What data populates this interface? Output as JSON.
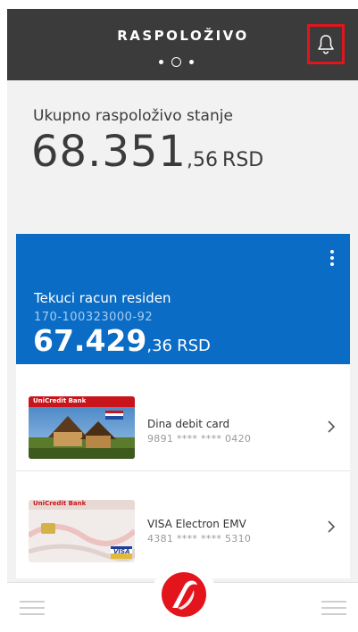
{
  "header": {
    "title": "RASPOLOŽIVO",
    "pager": {
      "count": 3,
      "active_index": 1
    }
  },
  "total": {
    "label": "Ukupno raspoloživo stanje",
    "amount_main": "68.351",
    "amount_decimals": ",56",
    "currency": "RSD"
  },
  "account": {
    "name": "Tekuci racun residen",
    "number": "170-100323000-92",
    "amount_main": "67.429",
    "amount_decimals": ",36",
    "currency": "RSD"
  },
  "cards": [
    {
      "name": "Dina debit card",
      "number": "9891 **** **** 0420",
      "bank_label": "UniCredit Bank"
    },
    {
      "name": "VISA Electron EMV",
      "number": "4381 **** **** 5310",
      "bank_label": "UniCredit Bank",
      "scheme_label": "VISA"
    }
  ],
  "colors": {
    "header_bg": "#3b3b3b",
    "accent_blue": "#0a6cc4",
    "brand_red": "#e3141b",
    "highlight_box": "#e3141b"
  },
  "icons": {
    "notifications": "bell-icon",
    "more": "kebab-menu-icon",
    "row_arrow": "chevron-right-icon",
    "menu": "hamburger-icon",
    "brand": "unicredit-logo-icon"
  }
}
